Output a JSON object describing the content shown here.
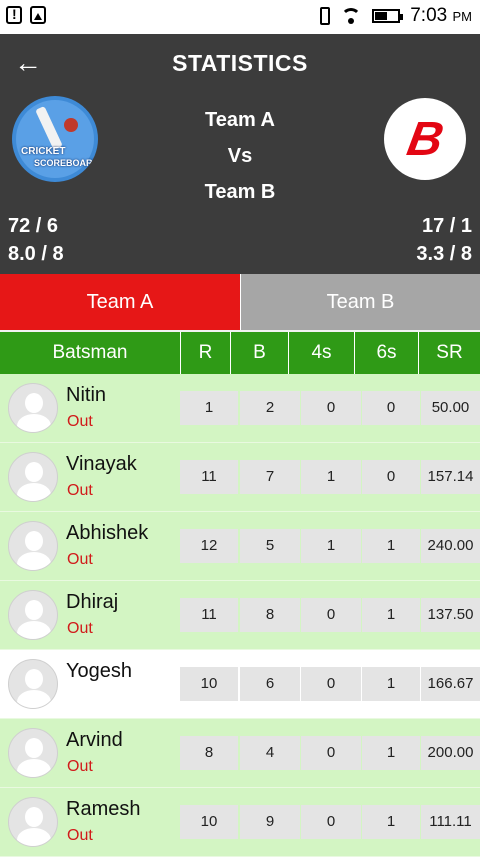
{
  "status_bar": {
    "time": "7:03",
    "ampm": "PM",
    "icons": [
      "alert-icon",
      "photo-icon",
      "vibrate-icon",
      "wifi-icon",
      "battery-icon"
    ]
  },
  "header": {
    "title": "STATISTICS",
    "back_icon": "←",
    "team1": "Team A",
    "vs": "Vs",
    "team2": "Team B",
    "logo_left_text1": "CRICKET",
    "logo_left_text2": "SCOREBOARD",
    "logo_right_mark": "B",
    "score_left_runs": "72 / 6",
    "score_left_overs": "8.0 / 8",
    "score_right_runs": "17 / 1",
    "score_right_overs": "3.3 / 8"
  },
  "tabs": [
    {
      "label": "Team A",
      "active": true
    },
    {
      "label": "Team B",
      "active": false
    }
  ],
  "table": {
    "headers": [
      "Batsman",
      "R",
      "B",
      "4s",
      "6s",
      "SR"
    ],
    "rows": [
      {
        "name": "Nitin",
        "status": "Out",
        "r": "1",
        "b": "2",
        "fours": "0",
        "sixes": "0",
        "sr": "50.00"
      },
      {
        "name": "Vinayak",
        "status": "Out",
        "r": "11",
        "b": "7",
        "fours": "1",
        "sixes": "0",
        "sr": "157.14"
      },
      {
        "name": "Abhishek",
        "status": "Out",
        "r": "12",
        "b": "5",
        "fours": "1",
        "sixes": "1",
        "sr": "240.00"
      },
      {
        "name": "Dhiraj",
        "status": "Out",
        "r": "11",
        "b": "8",
        "fours": "0",
        "sixes": "1",
        "sr": "137.50"
      },
      {
        "name": "Yogesh",
        "status": "",
        "r": "10",
        "b": "6",
        "fours": "0",
        "sixes": "1",
        "sr": "166.67"
      },
      {
        "name": "Arvind",
        "status": "Out",
        "r": "8",
        "b": "4",
        "fours": "0",
        "sixes": "1",
        "sr": "200.00"
      },
      {
        "name": "Ramesh",
        "status": "Out",
        "r": "10",
        "b": "9",
        "fours": "0",
        "sixes": "1",
        "sr": "111.11"
      }
    ]
  },
  "colors": {
    "header_bg": "#3c3c3c",
    "tab_active": "#e61717",
    "tab_inactive": "#a6a6a6",
    "table_header": "#2f9a16",
    "row_out": "#d3f5c3",
    "row_not_out": "#ffffff",
    "status_out": "#d11a1a"
  }
}
